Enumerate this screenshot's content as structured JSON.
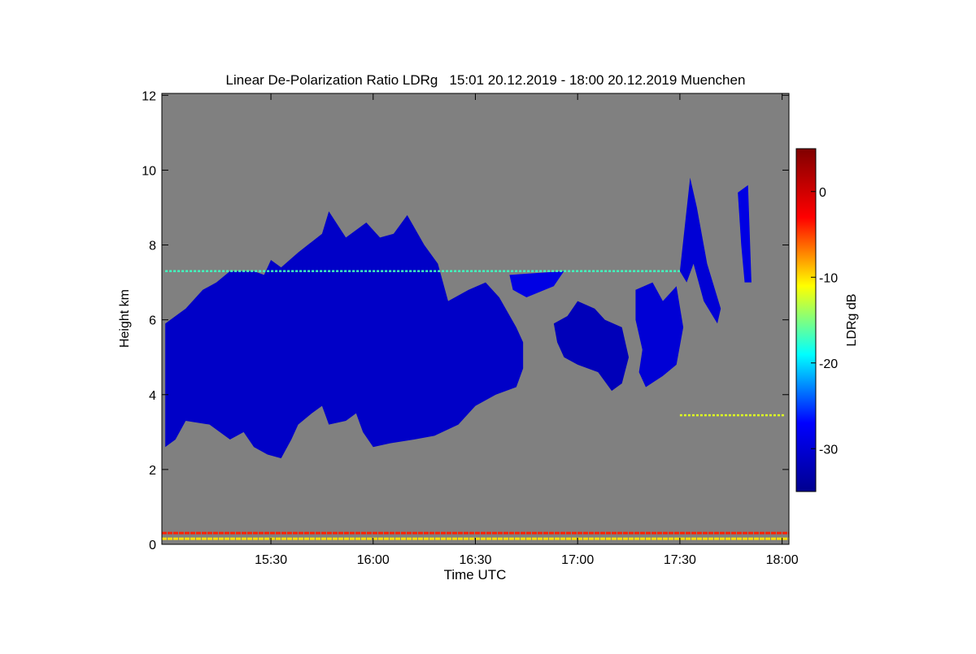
{
  "chart_data": {
    "type": "heatmap",
    "title": "Linear De-Polarization Ratio LDRg   15:01 20.12.2019 - 18:00 20.12.2019 Muenchen",
    "xlabel": "Time UTC",
    "ylabel": "Height km",
    "x_unit": "minutes after 15:00 UTC",
    "xlim": [
      -2,
      182
    ],
    "ylim": [
      0,
      12.05
    ],
    "xticks": [
      {
        "t": 30,
        "label": "15:30"
      },
      {
        "t": 60,
        "label": "16:00"
      },
      {
        "t": 90,
        "label": "16:30"
      },
      {
        "t": 120,
        "label": "17:00"
      },
      {
        "t": 150,
        "label": "17:30"
      },
      {
        "t": 180,
        "label": "18:00"
      }
    ],
    "yticks": [
      {
        "v": 0,
        "label": "0"
      },
      {
        "v": 2,
        "label": "2"
      },
      {
        "v": 4,
        "label": "4"
      },
      {
        "v": 6,
        "label": "6"
      },
      {
        "v": 8,
        "label": "8"
      },
      {
        "v": 10,
        "label": "10"
      },
      {
        "v": 12,
        "label": "12"
      }
    ],
    "background_color": "#808080",
    "colorbar": {
      "label": "LDRg dB",
      "range": [
        -35,
        5
      ],
      "ticks": [
        {
          "v": 0,
          "label": "0"
        },
        {
          "v": -10,
          "label": "-10"
        },
        {
          "v": -20,
          "label": "-20"
        },
        {
          "v": -30,
          "label": "-30"
        }
      ],
      "colormap": [
        "#00008f",
        "#0000ff",
        "#00ffff",
        "#ffff00",
        "#ff0000",
        "#800000"
      ]
    },
    "echo_regions": [
      {
        "name": "main-cloud",
        "ldr_db": -31,
        "points": [
          [
            -1,
            2.6
          ],
          [
            -1,
            5.9
          ],
          [
            5,
            6.3
          ],
          [
            10,
            6.8
          ],
          [
            14,
            7.0
          ],
          [
            18,
            7.3
          ],
          [
            25,
            7.3
          ],
          [
            28,
            7.2
          ],
          [
            30,
            7.6
          ],
          [
            33,
            7.4
          ],
          [
            38,
            7.8
          ],
          [
            45,
            8.3
          ],
          [
            47,
            8.9
          ],
          [
            52,
            8.2
          ],
          [
            58,
            8.6
          ],
          [
            62,
            8.2
          ],
          [
            66,
            8.3
          ],
          [
            70,
            8.8
          ],
          [
            75,
            8.0
          ],
          [
            79,
            7.5
          ],
          [
            82,
            6.5
          ],
          [
            88,
            6.8
          ],
          [
            93,
            7.0
          ],
          [
            97,
            6.6
          ],
          [
            102,
            5.8
          ],
          [
            104,
            5.4
          ],
          [
            104,
            4.7
          ],
          [
            102,
            4.2
          ],
          [
            96,
            4.0
          ],
          [
            90,
            3.7
          ],
          [
            85,
            3.2
          ],
          [
            78,
            2.9
          ],
          [
            72,
            2.8
          ],
          [
            65,
            2.7
          ],
          [
            60,
            2.6
          ],
          [
            57,
            3.0
          ],
          [
            55,
            3.5
          ],
          [
            52,
            3.3
          ],
          [
            47,
            3.2
          ],
          [
            45,
            3.7
          ],
          [
            42,
            3.5
          ],
          [
            38,
            3.2
          ],
          [
            36,
            2.8
          ],
          [
            33,
            2.3
          ],
          [
            29,
            2.4
          ],
          [
            25,
            2.6
          ],
          [
            22,
            3.0
          ],
          [
            18,
            2.8
          ],
          [
            12,
            3.2
          ],
          [
            5,
            3.3
          ],
          [
            2,
            2.8
          ]
        ]
      },
      {
        "name": "upper-patch",
        "ldr_db": -29,
        "points": [
          [
            100,
            7.2
          ],
          [
            116,
            7.3
          ],
          [
            113,
            6.9
          ],
          [
            105,
            6.6
          ],
          [
            101,
            6.8
          ]
        ]
      },
      {
        "name": "cloud-17-00",
        "ldr_db": -32,
        "points": [
          [
            113,
            5.9
          ],
          [
            117,
            6.1
          ],
          [
            120,
            6.5
          ],
          [
            125,
            6.3
          ],
          [
            128,
            6.0
          ],
          [
            133,
            5.8
          ],
          [
            135,
            5.0
          ],
          [
            133,
            4.3
          ],
          [
            130,
            4.1
          ],
          [
            126,
            4.6
          ],
          [
            120,
            4.8
          ],
          [
            116,
            5.0
          ],
          [
            114,
            5.4
          ]
        ]
      },
      {
        "name": "cloud-17-15",
        "ldr_db": -30,
        "points": [
          [
            137,
            6.8
          ],
          [
            142,
            7.0
          ],
          [
            145,
            6.5
          ],
          [
            149,
            6.9
          ],
          [
            151,
            5.8
          ],
          [
            149,
            4.8
          ],
          [
            145,
            4.5
          ],
          [
            140,
            4.2
          ],
          [
            138,
            4.6
          ],
          [
            139,
            5.2
          ],
          [
            137,
            6.0
          ]
        ]
      },
      {
        "name": "fallstreak-17-35",
        "ldr_db": -30,
        "points": [
          [
            150,
            7.3
          ],
          [
            153,
            9.8
          ],
          [
            155,
            9.0
          ],
          [
            158,
            7.5
          ],
          [
            162,
            6.3
          ],
          [
            161,
            5.9
          ],
          [
            157,
            6.5
          ],
          [
            154,
            7.5
          ],
          [
            152,
            7.0
          ]
        ]
      },
      {
        "name": "fallstreak-17-50",
        "ldr_db": -29,
        "points": [
          [
            167,
            9.4
          ],
          [
            170,
            9.6
          ],
          [
            171,
            7.0
          ],
          [
            169,
            7.0
          ],
          [
            168,
            8.0
          ]
        ]
      }
    ],
    "layers": [
      {
        "name": "layer-7-3km",
        "t0": -1,
        "t1": 150,
        "h": 7.3,
        "ldr_db": -17
      },
      {
        "name": "layer-3-5km",
        "t0": 150,
        "t1": 181,
        "h": 3.45,
        "ldr_db": -12
      },
      {
        "name": "ground-clutter-orange",
        "t0": -2,
        "t1": 182,
        "h": 0.3,
        "ldr_db": -4
      },
      {
        "name": "ground-clutter-yellow",
        "t0": -2,
        "t1": 182,
        "h": 0.15,
        "ldr_db": -10
      }
    ]
  }
}
